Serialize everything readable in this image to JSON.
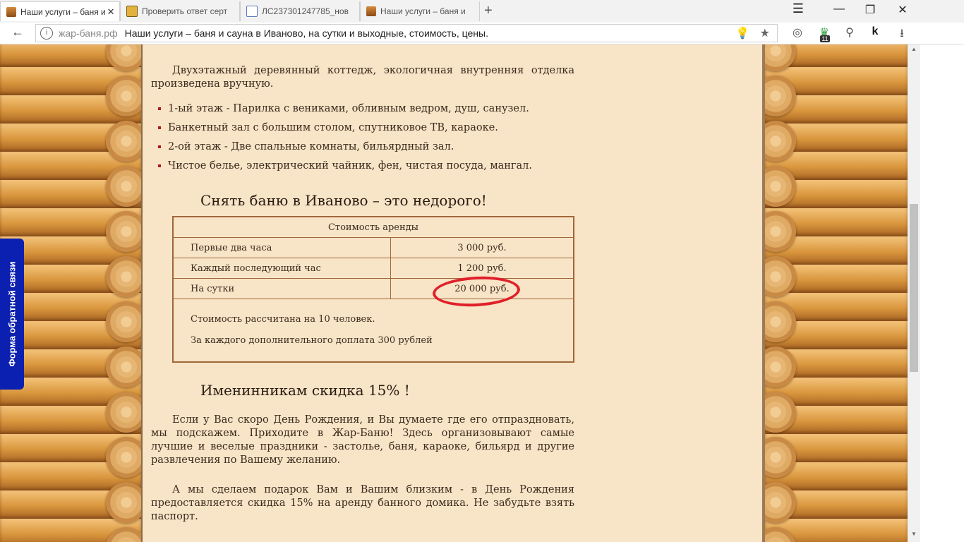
{
  "browser": {
    "tabs": [
      {
        "title": "Наши услуги – баня и",
        "active": true,
        "favicon": "flame-icon"
      },
      {
        "title": "Проверить ответ серт",
        "active": false,
        "favicon": "document-icon"
      },
      {
        "title": "ЛС237301247785_нов",
        "active": false,
        "favicon": "file-icon"
      },
      {
        "title": "Наши услуги – баня и",
        "active": false,
        "favicon": "flame-icon"
      }
    ],
    "close_glyph": "✕",
    "new_tab_glyph": "+",
    "window_controls": {
      "menu": "☰",
      "minimize": "—",
      "maximize": "❐",
      "close": "✕"
    },
    "address": {
      "domain": "жар-баня.рф",
      "page_title": "Наши услуги – баня и сауна в Иваново, на сутки и выходные, стоимость, цены."
    },
    "back_glyph": "←",
    "info_glyph": "i",
    "omni_icons": {
      "bulb": "💡",
      "star": "★"
    },
    "extensions": {
      "ext1": "◎",
      "ext2": "♛",
      "ext3": "⚲",
      "ext4": "k",
      "download": "⭳"
    },
    "extension_badge": "11"
  },
  "page": {
    "intro": "Двухэтажный деревянный коттедж, экологичная внутренняя отделка произведена вручную.",
    "bullets": [
      "1-ый этаж - Парилка с вениками, обливным ведром, душ, санузел.",
      "Банкетный зал с большим столом, спутниковое ТВ, караоке.",
      "2-ой этаж - Две спальные комнаты, бильярдный зал.",
      "Чистое белье, электрический чайник, фен, чистая посуда, мангал."
    ],
    "heading_price": "Снять баню в Иваново – это недорого!",
    "table": {
      "header": "Стоимость аренды",
      "rows": [
        {
          "label": "Первые два часа",
          "value": "3 000 руб."
        },
        {
          "label": "Каждый последующий час",
          "value": "1 200 руб."
        },
        {
          "label": "На сутки",
          "value": "20 000 руб."
        }
      ],
      "note1": "Стоимость рассчитана на 10 человек.",
      "note2": "За каждого дополнительного доплата 300 рублей"
    },
    "heading_birthday": "Именинникам скидка 15% !",
    "birthday_para1": "Если у Вас скоро День Рождения, и Вы думаете где его отпраздновать, мы подскажем. Приходите в Жар-Баню! Здесь организовывают самые лучшие и веселые праздники - застолье, баня, караоке, бильярд и другие развлечения по Вашему желанию.",
    "birthday_para2": "А мы сделаем подарок Вам и Вашим близким - в День Рождения предоставляется скидка 15% на аренду банного домика. Не забудьте взять паспорт."
  },
  "feedback_tab": "Форма обратной связи",
  "scroll_arrows": {
    "up": "▲",
    "down": "▼"
  },
  "colors": {
    "feedback": "#0b1fb0",
    "highlight_circle": "#e0202a",
    "content_bg": "#f8e4c6",
    "bullet": "#b01a1a"
  }
}
